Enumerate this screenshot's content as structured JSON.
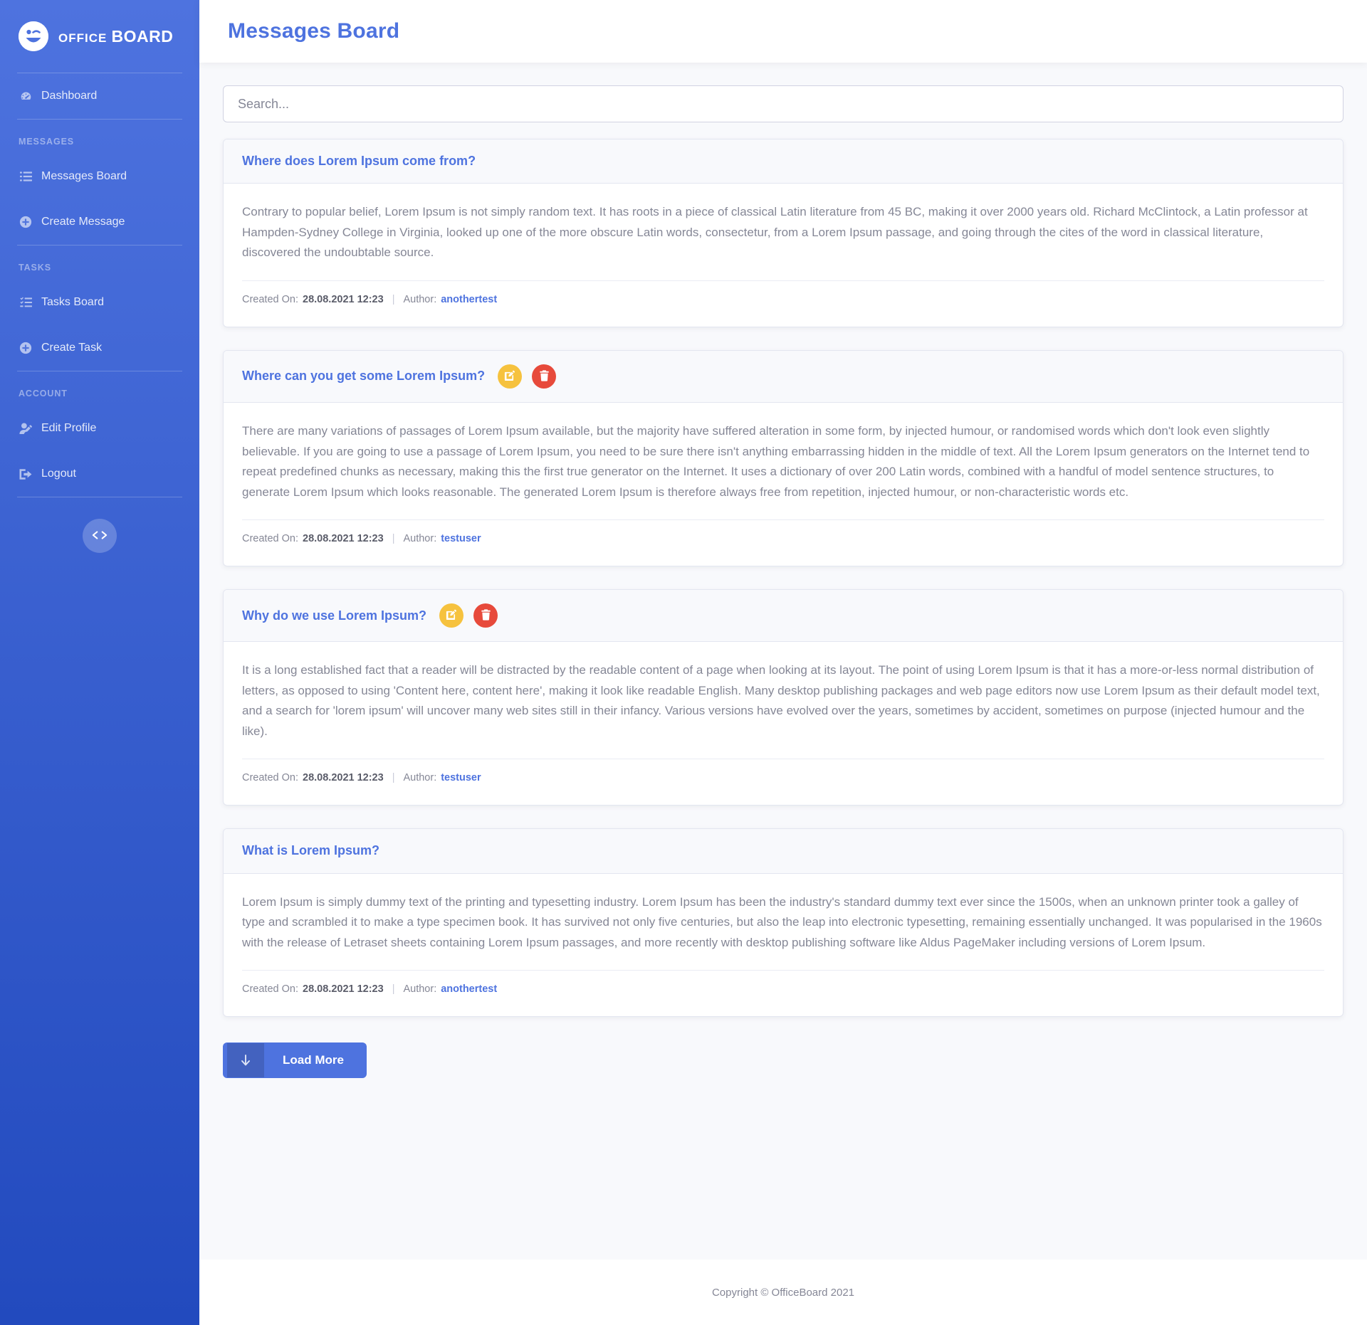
{
  "brand": {
    "logo_icon": "smiley-wink-icon",
    "name_small": "OFFICE",
    "name_large": "BOARD"
  },
  "sidebar": {
    "dashboard": {
      "label": "Dashboard",
      "icon": "tachometer-icon"
    },
    "sections": [
      {
        "heading": "MESSAGES",
        "items": [
          {
            "label": "Messages Board",
            "icon": "list-icon"
          },
          {
            "label": "Create Message",
            "icon": "plus-circle-icon"
          }
        ]
      },
      {
        "heading": "TASKS",
        "items": [
          {
            "label": "Tasks Board",
            "icon": "list-check-icon"
          },
          {
            "label": "Create Task",
            "icon": "plus-circle-icon"
          }
        ]
      },
      {
        "heading": "ACCOUNT",
        "items": [
          {
            "label": "Edit Profile",
            "icon": "user-edit-icon"
          },
          {
            "label": "Logout",
            "icon": "sign-out-icon"
          }
        ]
      }
    ],
    "code_toggle_icon": "code-icon"
  },
  "header": {
    "title": "Messages Board"
  },
  "search": {
    "placeholder": "Search...",
    "value": ""
  },
  "labels": {
    "created_on": "Created On:",
    "author": "Author:",
    "separator": "|",
    "edit_icon": "edit-pencil-square-icon",
    "delete_icon": "trash-icon"
  },
  "messages": [
    {
      "title": "Where does Lorem Ipsum come from?",
      "body": "Contrary to popular belief, Lorem Ipsum is not simply random text. It has roots in a piece of classical Latin literature from 45 BC, making it over 2000 years old. Richard McClintock, a Latin professor at Hampden-Sydney College in Virginia, looked up one of the more obscure Latin words, consectetur, from a Lorem Ipsum passage, and going through the cites of the word in classical literature, discovered the undoubtable source.",
      "created_on": "28.08.2021 12:23",
      "author": "anothertest",
      "has_actions": false
    },
    {
      "title": "Where can you get some Lorem Ipsum?",
      "body": "There are many variations of passages of Lorem Ipsum available, but the majority have suffered alteration in some form, by injected humour, or randomised words which don't look even slightly believable. If you are going to use a passage of Lorem Ipsum, you need to be sure there isn't anything embarrassing hidden in the middle of text. All the Lorem Ipsum generators on the Internet tend to repeat predefined chunks as necessary, making this the first true generator on the Internet. It uses a dictionary of over 200 Latin words, combined with a handful of model sentence structures, to generate Lorem Ipsum which looks reasonable. The generated Lorem Ipsum is therefore always free from repetition, injected humour, or non-characteristic words etc.",
      "created_on": "28.08.2021 12:23",
      "author": "testuser",
      "has_actions": true
    },
    {
      "title": "Why do we use Lorem Ipsum?",
      "body": "It is a long established fact that a reader will be distracted by the readable content of a page when looking at its layout. The point of using Lorem Ipsum is that it has a more-or-less normal distribution of letters, as opposed to using 'Content here, content here', making it look like readable English. Many desktop publishing packages and web page editors now use Lorem Ipsum as their default model text, and a search for 'lorem ipsum' will uncover many web sites still in their infancy. Various versions have evolved over the years, sometimes by accident, sometimes on purpose (injected humour and the like).",
      "created_on": "28.08.2021 12:23",
      "author": "testuser",
      "has_actions": true
    },
    {
      "title": "What is Lorem Ipsum?",
      "body": "Lorem Ipsum is simply dummy text of the printing and typesetting industry. Lorem Ipsum has been the industry's standard dummy text ever since the 1500s, when an unknown printer took a galley of type and scrambled it to make a type specimen book. It has survived not only five centuries, but also the leap into electronic typesetting, remaining essentially unchanged. It was popularised in the 1960s with the release of Letraset sheets containing Lorem Ipsum passages, and more recently with desktop publishing software like Aldus PageMaker including versions of Lorem Ipsum.",
      "created_on": "28.08.2021 12:23",
      "author": "anothertest",
      "has_actions": false
    }
  ],
  "load_more": {
    "label": "Load More",
    "icon": "arrow-down-icon"
  },
  "footer": {
    "copyright": "Copyright © OfficeBoard 2021"
  },
  "colors": {
    "primary": "#4e73df",
    "primary_dark": "#224abe",
    "edit": "#f6c23e",
    "delete": "#e74a3b",
    "page_bg": "#f8f9fc",
    "text_muted": "#858796"
  }
}
